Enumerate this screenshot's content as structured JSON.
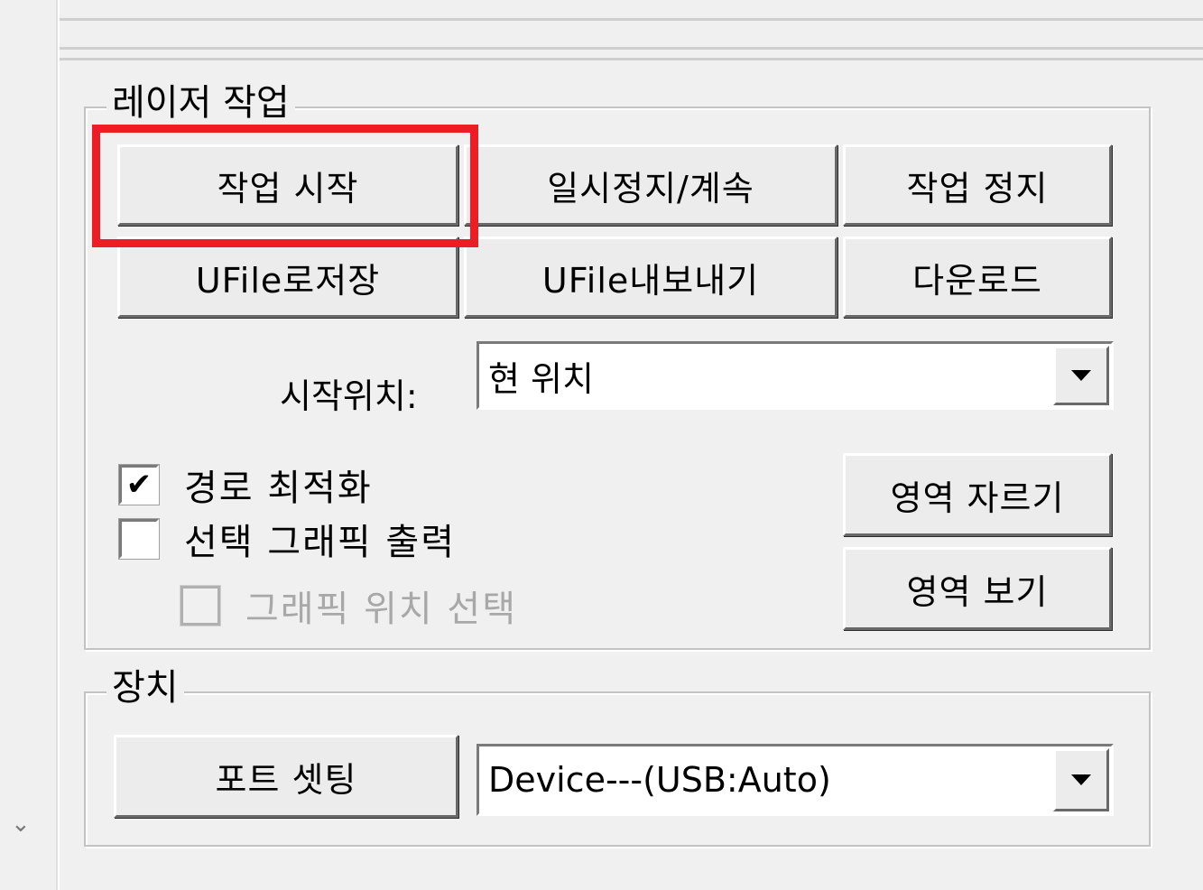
{
  "laser_group": {
    "title": "레이저 작업",
    "buttons": {
      "start_job": "작업 시작",
      "pause_resume": "일시정지/계속",
      "stop_job": "작업 정지",
      "save_ufile": "UFile로저장",
      "export_ufile": "UFile내보내기",
      "download": "다운로드",
      "crop_area": "영역 자르기",
      "view_area": "영역 보기"
    },
    "start_position": {
      "label": "시작위치:",
      "value": "현 위치"
    },
    "checkboxes": [
      {
        "label": "경로 최적화",
        "checked": true,
        "mark": "✔",
        "enabled": true
      },
      {
        "label": "선택 그래픽 출력",
        "checked": false,
        "mark": "",
        "enabled": true
      },
      {
        "label": "그래픽 위치 선택",
        "checked": false,
        "mark": "",
        "enabled": false
      }
    ]
  },
  "device_group": {
    "title": "장치",
    "port_button": "포트 셋팅",
    "device_select": "Device---(USB:Auto)"
  },
  "left_strip": {
    "icon": "chevron-down-icon",
    "glyph": "⌄"
  },
  "colors": {
    "highlight": "#ee1c25",
    "panel_bg": "#f0f0f0"
  }
}
